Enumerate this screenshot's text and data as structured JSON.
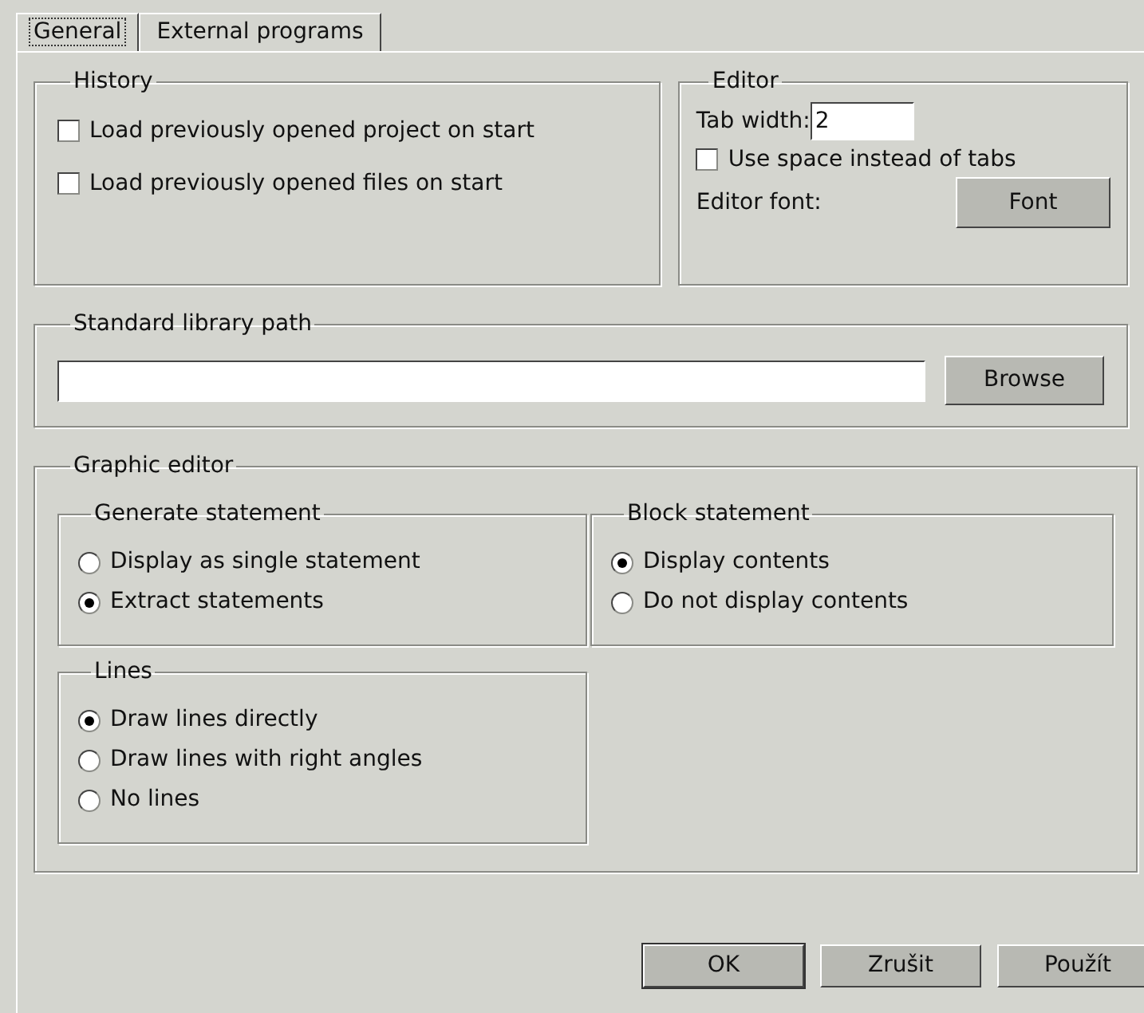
{
  "tabs": [
    {
      "label": "General",
      "selected": true
    },
    {
      "label": "External programs",
      "selected": false
    }
  ],
  "history": {
    "title": "History",
    "options": [
      {
        "label": "Load previously opened project on start",
        "checked": false
      },
      {
        "label": "Load previously opened files on start",
        "checked": false
      }
    ]
  },
  "editor": {
    "title": "Editor",
    "tab_width_label": "Tab width:",
    "tab_width_value": "2",
    "use_spaces": {
      "label": "Use space instead of tabs",
      "checked": false
    },
    "font_label": "Editor font:",
    "font_button": "Font"
  },
  "library": {
    "title": "Standard library path",
    "browse_button": "Browse"
  },
  "graphic_editor": {
    "title": "Graphic editor",
    "groups": [
      {
        "title": "Generate statement",
        "options": [
          {
            "label": "Display as single statement",
            "selected": false
          },
          {
            "label": "Extract statements",
            "selected": true
          }
        ]
      },
      {
        "title": "Block statement",
        "options": [
          {
            "label": "Display contents",
            "selected": true
          },
          {
            "label": "Do not display contents",
            "selected": false
          }
        ]
      },
      {
        "title": "Lines",
        "options": [
          {
            "label": "Draw lines directly",
            "selected": true
          },
          {
            "label": "Draw lines with right angles",
            "selected": false
          },
          {
            "label": "No lines",
            "selected": false
          }
        ]
      }
    ]
  },
  "buttons": [
    {
      "label": "OK",
      "default": true
    },
    {
      "label": "Zrušit",
      "default": false
    },
    {
      "label": "Použít",
      "default": false
    }
  ]
}
